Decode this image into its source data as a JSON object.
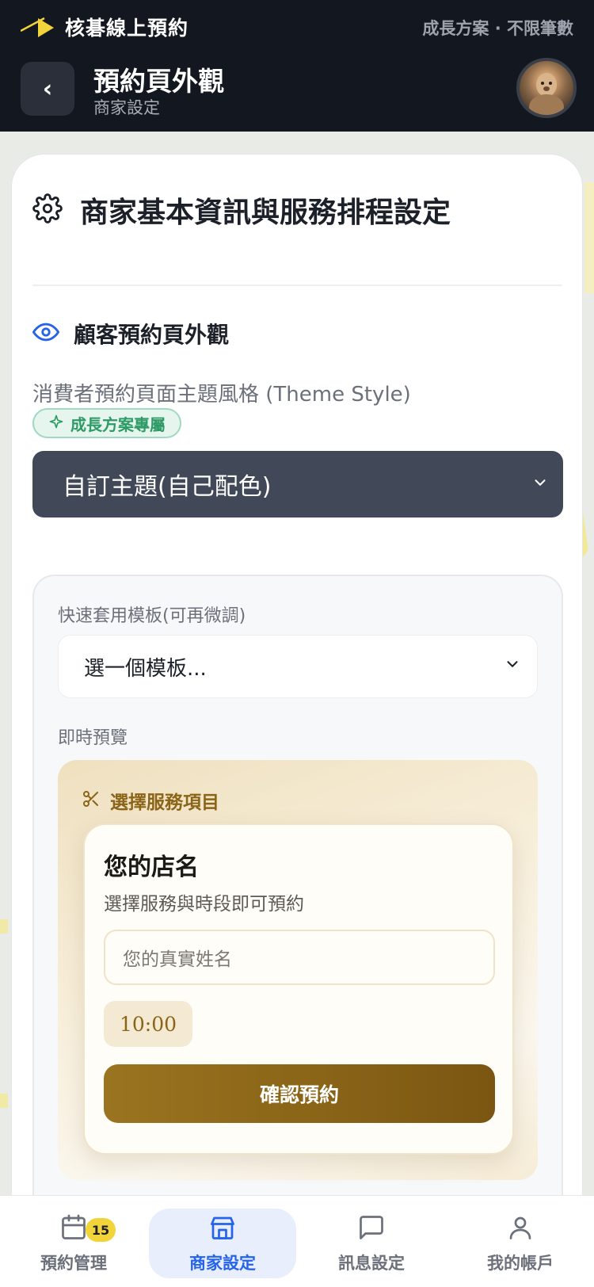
{
  "header": {
    "brand_name": "核碁線上預約",
    "plan_text": "成長方案 · 不限筆數",
    "back_label": "‹",
    "title": "預約頁外觀",
    "subtitle": "商家設定"
  },
  "card": {
    "section_title": "商家基本資訊與服務排程設定",
    "sub_title": "顧客預約頁外觀",
    "theme_label": "消費者預約頁面主題風格 (Theme Style)",
    "badge": "成長方案專屬",
    "theme_value": "自訂主題(自己配色)"
  },
  "template": {
    "label": "快速套用模板(可再微調)",
    "select_value": "選一個模板...",
    "preview_label": "即時預覽"
  },
  "preview": {
    "head": "選擇服務項目",
    "shop_name": "您的店名",
    "desc": "選擇服務與時段即可預約",
    "input_placeholder": "您的真實姓名",
    "time": "10:00",
    "confirm": "確認預約"
  },
  "nav": {
    "items": [
      {
        "label": "預約管理",
        "icon": "calendar-icon",
        "badge": "15"
      },
      {
        "label": "商家設定",
        "icon": "store-icon"
      },
      {
        "label": "訊息設定",
        "icon": "chat-icon"
      },
      {
        "label": "我的帳戶",
        "icon": "user-icon"
      }
    ],
    "active_index": 1
  },
  "colors": {
    "header_bg": "#131720",
    "accent_blue": "#2563eb",
    "select_dark": "#414858",
    "gold": "#8a6417",
    "badge_green": "#2e9a66",
    "nav_badge": "#f2d33a"
  }
}
